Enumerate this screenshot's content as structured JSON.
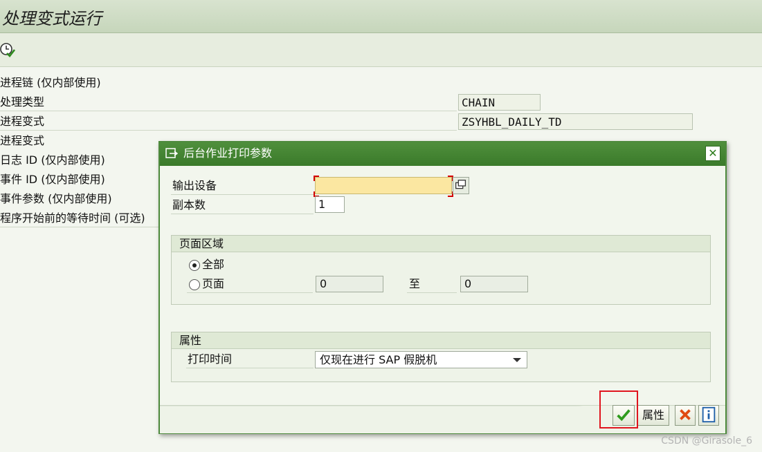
{
  "page": {
    "title": "处理变式运行"
  },
  "toolbar": {
    "execute_icon": "clock-check-icon"
  },
  "fields": {
    "items": [
      {
        "label": "进程链 (仅内部使用)",
        "value": ""
      },
      {
        "label": "处理类型",
        "value": "CHAIN"
      },
      {
        "label": "进程变式",
        "value": "ZSYHBL_DAILY_TD"
      },
      {
        "label": "进程变式",
        "value": ""
      },
      {
        "label": "日志 ID (仅内部使用)",
        "value": ""
      },
      {
        "label": "事件 ID (仅内部使用)",
        "value": ""
      },
      {
        "label": "事件参数 (仅内部使用)",
        "value": ""
      },
      {
        "label": "程序开始前的等待时间 (可选)",
        "value": ""
      }
    ]
  },
  "dialog": {
    "title": "后台作业打印参数",
    "output_device": {
      "label": "输出设备",
      "value": ""
    },
    "copies": {
      "label": "副本数",
      "value": "1"
    },
    "page_range": {
      "title": "页面区域",
      "all_label": "全部",
      "all_selected": true,
      "pages_label": "页面",
      "from_value": "0",
      "to_label": "至",
      "to_value": "0"
    },
    "properties": {
      "title": "属性",
      "print_time_label": "打印时间",
      "print_time_value": "仅现在进行 SAP 假脱机"
    },
    "buttons": {
      "confirm_icon": "checkmark-icon",
      "properties_label": "属性",
      "cancel_icon": "cancel-x-icon",
      "info_icon": "info-icon"
    }
  },
  "watermark": "CSDN @Girasole_6",
  "colors": {
    "header_green": "#3f7f2e",
    "required_field": "#fbe7a1",
    "highlight_red": "#e0141e"
  }
}
